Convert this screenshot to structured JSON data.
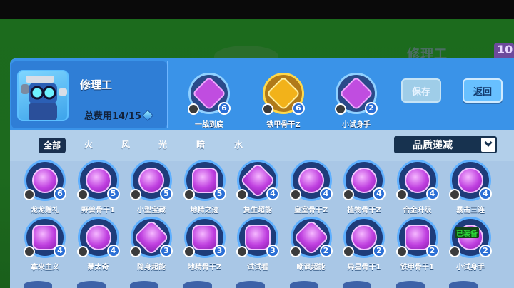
{
  "background": {
    "title": "修理工",
    "badge": "10"
  },
  "hero": {
    "name": "修理工",
    "cost_label": "总费用14/15"
  },
  "equipped": [
    {
      "label": "一战到底",
      "level": "6",
      "gold": false
    },
    {
      "label": "铁甲骨干Z",
      "level": "6",
      "gold": true
    },
    {
      "label": "小试身手",
      "level": "2",
      "gold": false
    }
  ],
  "buttons": {
    "save": "保存",
    "back": "返回"
  },
  "filters": [
    "全部",
    "火",
    "风",
    "光",
    "暗",
    "水"
  ],
  "sort": {
    "label": "品质递减"
  },
  "items": [
    {
      "label": "龙龙赠礼",
      "level": "6",
      "shape": "round"
    },
    {
      "label": "野兽骨干1",
      "level": "5",
      "shape": "round"
    },
    {
      "label": "小型宝藏",
      "level": "5",
      "shape": "round"
    },
    {
      "label": "地精之迹",
      "level": "5",
      "shape": "hex"
    },
    {
      "label": "复生超能",
      "level": "4",
      "shape": "sq"
    },
    {
      "label": "皇室骨干Z",
      "level": "4",
      "shape": "round"
    },
    {
      "label": "植物骨干Z",
      "level": "4",
      "shape": "round"
    },
    {
      "label": "合金升级",
      "level": "4",
      "shape": "round"
    },
    {
      "label": "暴击三连",
      "level": "4",
      "shape": "round"
    },
    {
      "label": "拿来主义",
      "level": "4",
      "shape": "hex"
    },
    {
      "label": "蒙太奇",
      "level": "4",
      "shape": "round"
    },
    {
      "label": "隐身超能",
      "level": "3",
      "shape": "sq"
    },
    {
      "label": "地精骨干Z",
      "level": "3",
      "shape": "hex"
    },
    {
      "label": "试试看",
      "level": "3",
      "shape": "hex"
    },
    {
      "label": "嘲讽超能",
      "level": "2",
      "shape": "sq"
    },
    {
      "label": "异星骨干1",
      "level": "2",
      "shape": "round"
    },
    {
      "label": "铁甲骨干1",
      "level": "2",
      "shape": "hex"
    },
    {
      "label": "小试身手",
      "level": "2",
      "shape": "round",
      "tag": "已装备"
    }
  ]
}
